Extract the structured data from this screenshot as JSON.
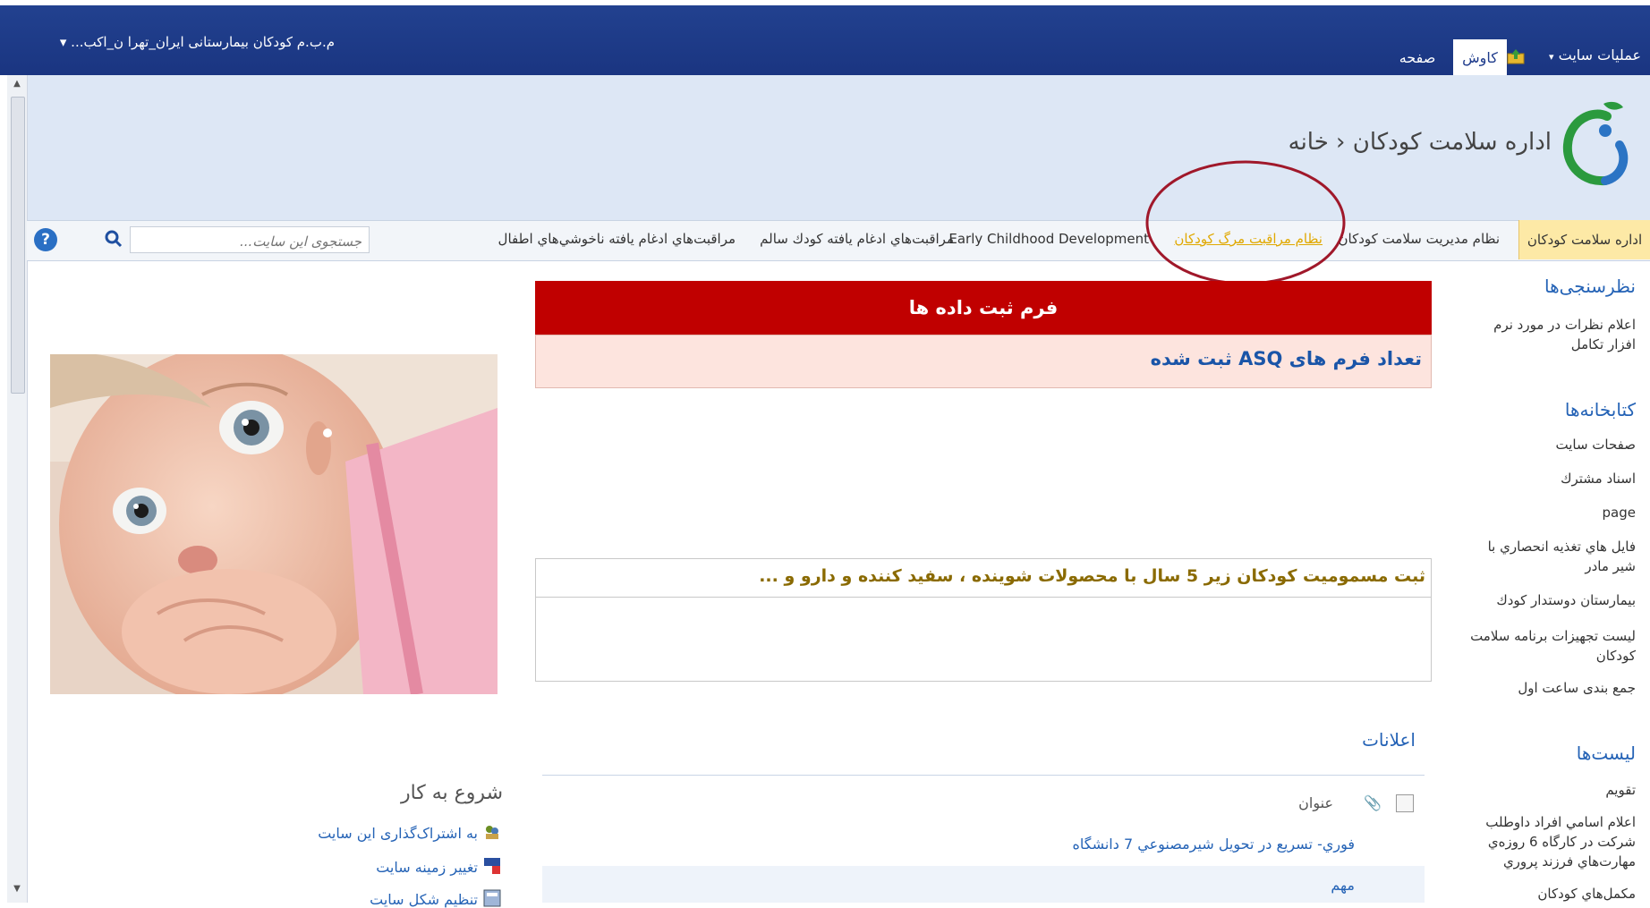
{
  "topbar": {
    "site_selector": "م.ب.م كودكان بيمارستانی ايران_تهرا ن_اكب... ▾",
    "site_actions": "عمليات سايت",
    "tabs": [
      {
        "label": "كاوش",
        "selected": true
      },
      {
        "label": "صفحه",
        "selected": false
      }
    ]
  },
  "header": {
    "breadcrumb": "اداره سلامت كودكان ‹ خانه"
  },
  "nav": {
    "items": [
      {
        "label": "اداره سلامت كودكان",
        "selected": true
      },
      {
        "label": "نظام مديريت سلامت كودكان"
      },
      {
        "label": "نظام مراقبت مرگ كودكان",
        "highlighted": true
      },
      {
        "label": "Early Childhood Development"
      },
      {
        "label": "مراقبت‌هاي ادغام يافته كودك سالم"
      },
      {
        "label": "مراقبت‌هاي ادغام يافته ناخوشي‌هاي اطفال"
      }
    ],
    "search_placeholder": "جستجوی اين سايت...",
    "help": "?"
  },
  "quicklaunch": {
    "surveys_heading": "نظرسنجی‌ها",
    "surveys": [
      "اعلام نظرات در مورد نرم افزار تكامل"
    ],
    "libraries_heading": "كتابخانه‌ها",
    "libraries": [
      "صفحات سايت",
      "اسناد مشترك",
      "page",
      "فايل هاي تغذيه انحصاري با شير مادر",
      "بيمارستان دوستدار كودك",
      "ليست تجهيزات برنامه سلامت كودكان",
      "جمع بندی ساعت اول"
    ],
    "lists_heading": "ليست‌ها",
    "lists": [
      "تقويم",
      "اعلام اسامي افراد داوطلب شركت در كارگاه 6 روزه‌ي مهارت‌هاي فرزند پروري",
      "مكمل‌هاي كودكان"
    ]
  },
  "main": {
    "form_title": "فرم ثبت داده ها",
    "asq_link": "تعداد فرم های ASQ ثبت شده",
    "poison_title": "ثبت مسموميت كودكان زير 5 سال با محصولات شوينده ، سفيد كننده و دارو و ...",
    "announcements": {
      "title": "اعلانات",
      "column": "عنوان",
      "items": [
        "فوري- تسريع در تحويل شيرمصنوعي 7 دانشگاه",
        "مهم"
      ]
    }
  },
  "getting_started": {
    "title": "شروع به كار",
    "items": [
      "به اشتراک‌گذاری اين سايت",
      "تغيير زمينه سايت",
      "تنظيم شكل سايت"
    ]
  },
  "colors": {
    "topbar": "#1f3c8c",
    "header_bg": "#dde7f5",
    "form_header": "#c00000",
    "link": "#2563b6",
    "nav_selected": "#fde9a6"
  }
}
